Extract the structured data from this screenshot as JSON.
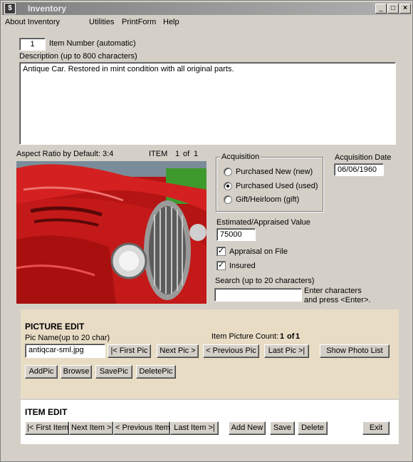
{
  "window": {
    "title": "Inventory",
    "minimize": "_",
    "maximize": "□",
    "close": "×"
  },
  "menu": [
    "About Inventory",
    "Utilities",
    "PrintForm",
    "Help"
  ],
  "item_number": {
    "value": "1",
    "label": "Item Number (automatic)"
  },
  "description": {
    "label": "Description (up to 800 characters)",
    "value": "Antique Car. Restored in mint condition with all original parts."
  },
  "image_info": {
    "aspect_ratio": "Aspect Ratio by Default: 3:4",
    "item_word": "ITEM",
    "index": "1",
    "of_word": "of",
    "total": "1"
  },
  "acquisition": {
    "title": "Acquisition",
    "options": [
      "Purchased New (new)",
      "Purchased Used (used)",
      "Gift/Heirloom (gift)"
    ],
    "selected_index": 1
  },
  "acquisition_date": {
    "label": "Acquisition Date",
    "value": "06/06/1960"
  },
  "appraised_value": {
    "label": "Estimated/Appraised Value",
    "value": "75000"
  },
  "appraisal_on_file": {
    "label": "Appraisal on File",
    "checked": true,
    "mark": "✓"
  },
  "insured": {
    "label": "Insured",
    "checked": true,
    "mark": "✓"
  },
  "search": {
    "label": "Search (up to 20 characters)",
    "value": "",
    "hint_line1": "Enter characters",
    "hint_line2": "and press <Enter>."
  },
  "picture_edit": {
    "title": "PICTURE EDIT",
    "pic_name_label": "Pic Name(up to 20 char)",
    "pic_name_value": "antiqcar-sml.jpg",
    "count_label": "Item Picture Count:",
    "count_value": "1",
    "count_of": "of",
    "count_total": "1",
    "buttons": {
      "first": "|< First Pic",
      "next": "Next Pic >",
      "previous": "< Previous Pic",
      "last": "Last Pic >|",
      "show_list": "Show Photo List",
      "add": "AddPic",
      "browse": "Browse",
      "save": "SavePic",
      "delete": "DeletePic"
    }
  },
  "item_edit": {
    "title": "ITEM EDIT",
    "buttons": {
      "first": "|< First Item",
      "next": "Next Item >",
      "previous": "< Previous Item",
      "last": "Last Item >|",
      "add_new": "Add New",
      "save": "Save",
      "delete": "Delete",
      "exit": "Exit"
    }
  },
  "colors": {
    "window_bg": "#d4d0c8",
    "picture_panel": "#e8dcc5",
    "item_panel": "#ffffff",
    "car_red": "#c21818"
  }
}
